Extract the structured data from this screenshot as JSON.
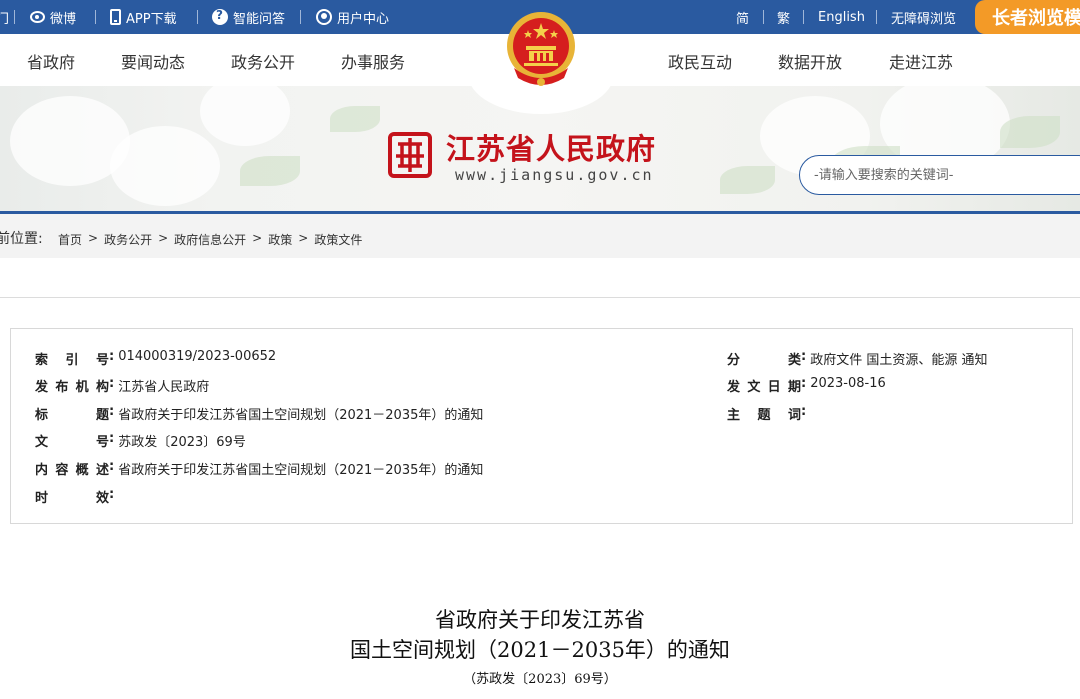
{
  "topbar": {
    "left_cut": "门",
    "weibo": "微博",
    "app": "APP下载",
    "qa": "智能问答",
    "user_center": "用户中心",
    "simplified": "简",
    "traditional": "繁",
    "english": "English",
    "accessible": "无障碍浏览",
    "elder": "长者浏览模"
  },
  "nav": {
    "items_left": [
      "省政府",
      "要闻动态",
      "政务公开",
      "办事服务"
    ],
    "items_right": [
      "政民互动",
      "数据开放",
      "走进江苏"
    ]
  },
  "header": {
    "site_title": "江苏省人民政府",
    "site_domain": "www.jiangsu.gov.cn",
    "search_placeholder": "-请输入要搜索的关键词-"
  },
  "breadcrumb": {
    "label": "前位置:",
    "items": [
      "首页",
      "政务公开",
      "政府信息公开",
      "政策",
      "政策文件"
    ],
    "sep": ">"
  },
  "info": {
    "index_label": [
      "索",
      "引",
      "号"
    ],
    "index_value": "014000319/2023-00652",
    "org_label": [
      "发",
      "布",
      "机",
      "构"
    ],
    "org_value": "江苏省人民政府",
    "title_label": [
      "标",
      "题"
    ],
    "title_value": "省政府关于印发江苏省国土空间规划（2021－2035年）的通知",
    "docno_label": [
      "文",
      "号"
    ],
    "docno_value": "苏政发〔2023〕69号",
    "summary_label": [
      "内",
      "容",
      "概",
      "述"
    ],
    "summary_value": "省政府关于印发江苏省国土空间规划（2021－2035年）的通知",
    "validity_label": [
      "时",
      "效"
    ],
    "validity_value": "",
    "category_label": [
      "分",
      "类"
    ],
    "category_value": "政府文件 国土资源、能源 通知",
    "date_label": [
      "发",
      "文",
      "日",
      "期"
    ],
    "date_value": "2023-08-16",
    "subject_label": [
      "主",
      "题",
      "词"
    ],
    "subject_value": ""
  },
  "document": {
    "title_line1": "省政府关于印发江苏省",
    "title_line2": "国土空间规划（2021－2035年）的通知",
    "doc_number": "（苏政发〔2023〕69号）"
  },
  "colors": {
    "brand_blue": "#2a5aa0",
    "title_red": "#c4131b",
    "elder_orange": "#f39a27"
  }
}
